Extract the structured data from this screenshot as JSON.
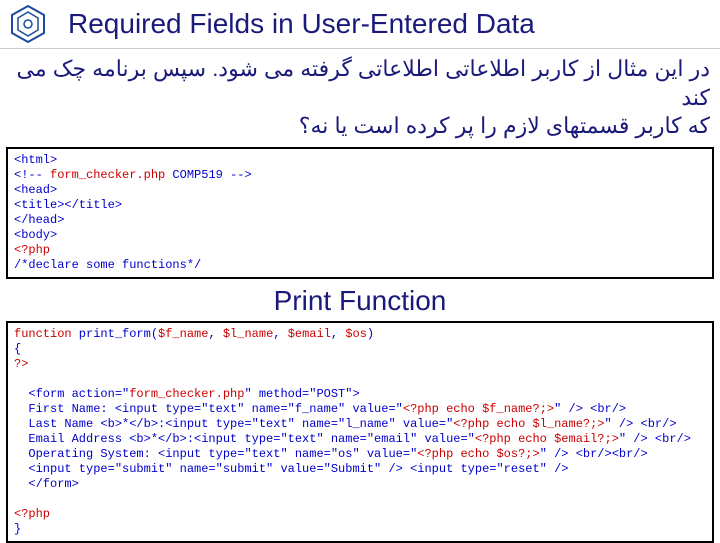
{
  "header": {
    "title": "Required Fields in User-Entered Data"
  },
  "arabic": {
    "line1": "در این مثال از کاربر اطلاعاتی اطلاعاتی گرفته می شود. سپس برنامه چک می کند",
    "line2": "که کاربر قسمتهای لازم را پر کرده است یا نه؟"
  },
  "code1": {
    "l1": "<html>",
    "l2a": "<!-- ",
    "l2b": "form_checker.php",
    "l2c": " COMP519 -->",
    "l3": "<head>",
    "l4": "<title></title>",
    "l5": "</head>",
    "l6": "<body>",
    "l7": "<?php",
    "l8": "/*declare some functions*/"
  },
  "subtitle": "Print Function",
  "code2": {
    "fn_kw": "function",
    "fn_name": " print_form(",
    "a1": "$f_name",
    "a2": "$l_name",
    "a3": "$email",
    "a4": "$os",
    "brace": "{",
    "close_php": "?>",
    "form_open_a": "  <form action=\"",
    "form_open_b": "form_checker.php",
    "form_open_c": "\" method=\"POST\">",
    "fn_line_a": "  First Name: <input type=\"text\" name=\"f_name\" value=\"",
    "fn_echo": "<?php echo $f_name?;>",
    "ln_line_a": "  Last Name <b>*</b>:<input type=\"text\" name=\"l_name\" value=\"",
    "ln_echo": "<?php echo $l_name?;>",
    "em_line_a": "  Email Address <b>*</b>:<input type=\"text\" name=\"email\" value=\"",
    "em_echo": "<?php echo $email?;>",
    "os_line_a": "  Operating System: <input type=\"text\" name=\"os\" value=\"",
    "os_echo": "<?php echo $os?;>",
    "end_input": "\" /> <br/>",
    "end_input_br": "\" /> <br/><br/>",
    "submit": "  <input type=\"submit\" name=\"submit\" value=\"Submit\" /> <input type=\"reset\" />",
    "form_close": "  </form>",
    "open_php": "<?php",
    "brace2": "}"
  }
}
